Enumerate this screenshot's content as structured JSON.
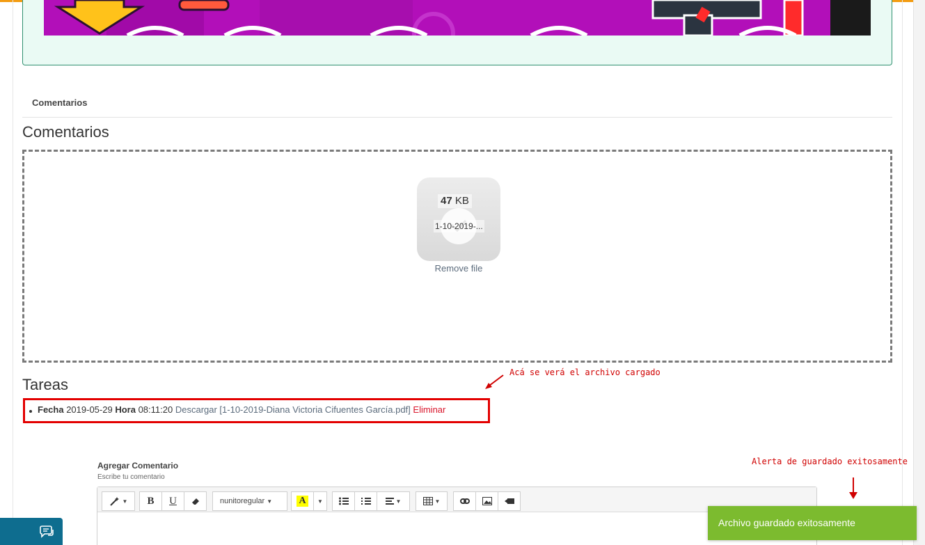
{
  "tabs": [
    {
      "label": "Comentarios",
      "active": true
    }
  ],
  "sections": {
    "comentarios_title": "Comentarios",
    "tareas_title": "Tareas"
  },
  "upload": {
    "file_size_value": "47",
    "file_size_unit": "KB",
    "file_name": "1-10-2019-...",
    "remove_label": "Remove file"
  },
  "tareas": [
    {
      "fecha_label": "Fecha",
      "fecha": "2019-05-29",
      "hora_label": "Hora",
      "hora": "08:11:20",
      "download_label": "Descargar [1-10-2019-Diana Victoria Cifuentes García.pdf]",
      "delete_label": "Eliminar"
    }
  ],
  "annotations": {
    "uploaded_file": "Acá se verá el archivo cargado",
    "save_alert": "Alerta de guardado exitosamente"
  },
  "comment_form": {
    "label": "Agregar Comentario",
    "hint": "Escribe tu comentario",
    "font_value": "nunitoregular",
    "toolbar_bold": "B",
    "toolbar_underline": "U",
    "toolbar_color": "A"
  },
  "toast": {
    "message": "Archivo guardado exitosamente",
    "color": "#7cbb2f"
  },
  "icons": {
    "chat": "chat-bubbles-icon",
    "magic": "magic-wand-icon",
    "eraser": "eraser-icon"
  },
  "colors": {
    "accent": "#f39c12",
    "link": "#5b6b7c",
    "danger": "#d9152b",
    "annotation": "#d00000",
    "chat_button": "#0e6d8f"
  }
}
